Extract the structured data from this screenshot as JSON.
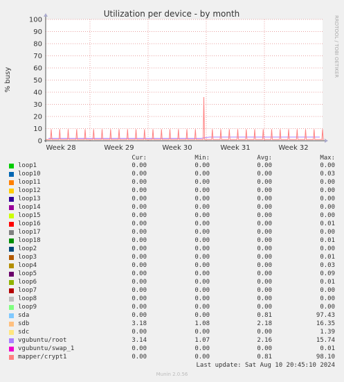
{
  "chart_data": {
    "type": "line",
    "title": "Utilization per device - by month",
    "ylabel": "% busy",
    "ylim": [
      0,
      100
    ],
    "yticks": [
      0,
      10,
      20,
      30,
      40,
      50,
      60,
      70,
      80,
      90,
      100
    ],
    "xticks": [
      "Week 28",
      "Week 29",
      "Week 30",
      "Week 31",
      "Week 32"
    ],
    "grid": true,
    "watermark": "RRDTOOL / TOBI OETIKER",
    "series_main": {
      "name": "mapper/crypt1",
      "baseline": 1.0,
      "spikes": [
        9.5,
        9.5,
        9.5,
        9.5,
        9.5,
        9.5,
        9.5,
        9.5,
        9.5,
        9.5,
        9.5,
        9.5,
        9.5,
        9.5,
        9.5,
        9.5,
        9.5,
        9.5,
        36.0,
        9.5,
        9.5,
        9.5,
        9.5,
        9.5,
        9.5,
        9.5,
        9.5,
        9.5,
        9.5,
        9.5,
        9.5,
        9.5,
        9.5
      ]
    },
    "series_low": {
      "name": "sdb / vgubuntu/root",
      "values": [
        2,
        2,
        2,
        2,
        2,
        2,
        2,
        2,
        2,
        2,
        2,
        2,
        2,
        2,
        2,
        2,
        2,
        2,
        2,
        3,
        3,
        3,
        3,
        3,
        3,
        3,
        3,
        3,
        3,
        3,
        3,
        3,
        3
      ]
    }
  },
  "legend": {
    "headers": {
      "cur": "Cur:",
      "min": "Min:",
      "avg": "Avg:",
      "max": "Max:"
    },
    "rows": [
      {
        "name": "loop1",
        "color": "#00cc00",
        "cur": "0.00",
        "min": "0.00",
        "avg": "0.00",
        "max": "0.00"
      },
      {
        "name": "loop10",
        "color": "#0066b3",
        "cur": "0.00",
        "min": "0.00",
        "avg": "0.00",
        "max": "0.03"
      },
      {
        "name": "loop11",
        "color": "#ff8000",
        "cur": "0.00",
        "min": "0.00",
        "avg": "0.00",
        "max": "0.00"
      },
      {
        "name": "loop12",
        "color": "#ffcc00",
        "cur": "0.00",
        "min": "0.00",
        "avg": "0.00",
        "max": "0.00"
      },
      {
        "name": "loop13",
        "color": "#330099",
        "cur": "0.00",
        "min": "0.00",
        "avg": "0.00",
        "max": "0.00"
      },
      {
        "name": "loop14",
        "color": "#990099",
        "cur": "0.00",
        "min": "0.00",
        "avg": "0.00",
        "max": "0.00"
      },
      {
        "name": "loop15",
        "color": "#ccff00",
        "cur": "0.00",
        "min": "0.00",
        "avg": "0.00",
        "max": "0.00"
      },
      {
        "name": "loop16",
        "color": "#ff0000",
        "cur": "0.00",
        "min": "0.00",
        "avg": "0.00",
        "max": "0.01"
      },
      {
        "name": "loop17",
        "color": "#808080",
        "cur": "0.00",
        "min": "0.00",
        "avg": "0.00",
        "max": "0.00"
      },
      {
        "name": "loop18",
        "color": "#008f00",
        "cur": "0.00",
        "min": "0.00",
        "avg": "0.00",
        "max": "0.01"
      },
      {
        "name": "loop2",
        "color": "#00487d",
        "cur": "0.00",
        "min": "0.00",
        "avg": "0.00",
        "max": "0.00"
      },
      {
        "name": "loop3",
        "color": "#b35a00",
        "cur": "0.00",
        "min": "0.00",
        "avg": "0.00",
        "max": "0.01"
      },
      {
        "name": "loop4",
        "color": "#b38f00",
        "cur": "0.00",
        "min": "0.00",
        "avg": "0.00",
        "max": "0.03"
      },
      {
        "name": "loop5",
        "color": "#6b006b",
        "cur": "0.00",
        "min": "0.00",
        "avg": "0.00",
        "max": "0.09"
      },
      {
        "name": "loop6",
        "color": "#8fb300",
        "cur": "0.00",
        "min": "0.00",
        "avg": "0.00",
        "max": "0.01"
      },
      {
        "name": "loop7",
        "color": "#b30000",
        "cur": "0.00",
        "min": "0.00",
        "avg": "0.00",
        "max": "0.00"
      },
      {
        "name": "loop8",
        "color": "#bebebe",
        "cur": "0.00",
        "min": "0.00",
        "avg": "0.00",
        "max": "0.00"
      },
      {
        "name": "loop9",
        "color": "#80ff80",
        "cur": "0.00",
        "min": "0.00",
        "avg": "0.00",
        "max": "0.00"
      },
      {
        "name": "sda",
        "color": "#80c9ff",
        "cur": "0.00",
        "min": "0.00",
        "avg": "0.81",
        "max": "97.43"
      },
      {
        "name": "sdb",
        "color": "#ffc080",
        "cur": "3.18",
        "min": "1.08",
        "avg": "2.18",
        "max": "16.35"
      },
      {
        "name": "sdc",
        "color": "#ffe680",
        "cur": "0.00",
        "min": "0.00",
        "avg": "0.00",
        "max": "1.39"
      },
      {
        "name": "vgubuntu/root",
        "color": "#aa80ff",
        "cur": "3.14",
        "min": "1.07",
        "avg": "2.16",
        "max": "15.74"
      },
      {
        "name": "vgubuntu/swap_1",
        "color": "#ee00cc",
        "cur": "0.00",
        "min": "0.00",
        "avg": "0.00",
        "max": "0.01"
      },
      {
        "name": "mapper/crypt1",
        "color": "#ff8080",
        "cur": "0.00",
        "min": "0.00",
        "avg": "0.81",
        "max": "98.10"
      }
    ]
  },
  "footer": {
    "last_update": "Last update: Sat Aug 10 20:45:10 2024",
    "version": "Munin 2.0.56"
  }
}
